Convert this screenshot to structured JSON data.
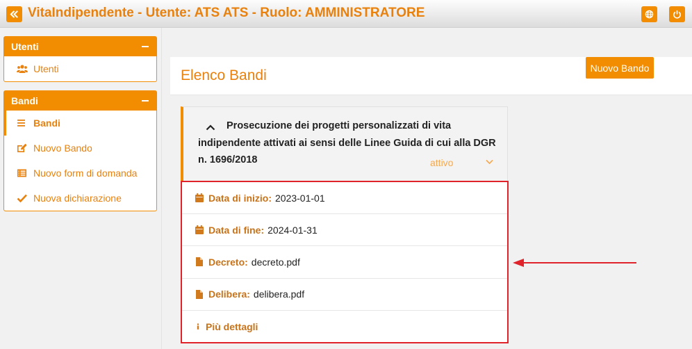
{
  "header": {
    "title": "VitaIndipendente - Utente: ATS ATS - Ruolo: AMMINISTRATORE",
    "toggle_icon": "double-chevron-left-icon",
    "language_icon": "globe-icon",
    "logout_icon": "power-icon"
  },
  "sidebar": {
    "panels": [
      {
        "title": "Utenti",
        "items": [
          {
            "label": "Utenti",
            "icon": "users-icon"
          }
        ]
      },
      {
        "title": "Bandi",
        "items": [
          {
            "label": "Bandi",
            "icon": "list-icon",
            "active": true
          },
          {
            "label": "Nuovo Bando",
            "icon": "edit-icon"
          },
          {
            "label": "Nuovo form di domanda",
            "icon": "form-list-icon"
          },
          {
            "label": "Nuova dichiarazione",
            "icon": "check-icon"
          }
        ]
      }
    ]
  },
  "main": {
    "page_title": "Elenco Bandi",
    "new_button": "Nuovo Bando",
    "bando": {
      "title": "Prosecuzione dei progetti personalizzati di vita indipendente attivati ai sensi delle Linee Guida di cui alla DGR n. 1696/2018",
      "status": "attivo",
      "details": [
        {
          "label": "Data di inizio:",
          "value": "2023-01-01",
          "icon": "calendar-icon"
        },
        {
          "label": "Data di fine:",
          "value": "2024-01-31",
          "icon": "calendar-icon"
        },
        {
          "label": "Decreto:",
          "value": "decreto.pdf",
          "icon": "file-icon"
        },
        {
          "label": "Delibera:",
          "value": "delibera.pdf",
          "icon": "file-icon"
        },
        {
          "label": "Più dettagli",
          "value": "",
          "icon": "info-icon"
        }
      ]
    }
  },
  "colors": {
    "accent": "#f28c00",
    "text_orange": "#e8810d",
    "highlight_border": "#e0222b"
  }
}
